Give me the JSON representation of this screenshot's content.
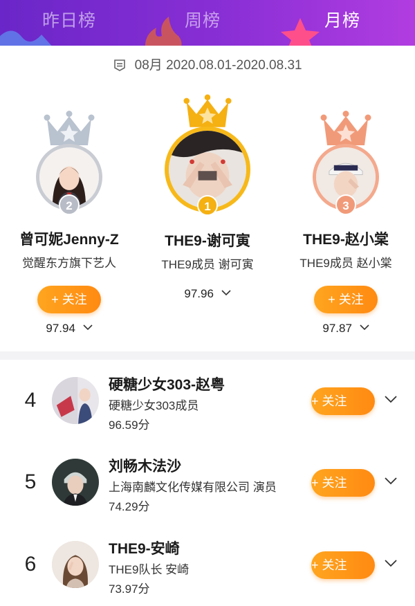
{
  "tabs": [
    {
      "label": "昨日榜",
      "active": false
    },
    {
      "label": "周榜",
      "active": false
    },
    {
      "label": "月榜",
      "active": true
    }
  ],
  "period": {
    "month": "08月",
    "range": "2020.08.01-2020.08.31"
  },
  "podium": [
    {
      "rank": "2",
      "name": "曾可妮Jenny-Z",
      "subtitle": "觉醒东方旗下艺人",
      "follow_label": "+ 关注",
      "score": "97.94",
      "crown_color": "#b9c2cf"
    },
    {
      "rank": "1",
      "name": "THE9-谢可寅",
      "subtitle": "THE9成员 谢可寅",
      "score": "97.96",
      "crown_color": "#f5b012"
    },
    {
      "rank": "3",
      "name": "THE9-赵小棠",
      "subtitle": "THE9成员 赵小棠",
      "follow_label": "+ 关注",
      "score": "97.87",
      "crown_color": "#f19a79"
    }
  ],
  "list": [
    {
      "rank": "4",
      "name": "硬糖少女303-赵粤",
      "subtitle": "硬糖少女303成员",
      "score": "96.59分",
      "follow_label": "+ 关注"
    },
    {
      "rank": "5",
      "name": "刘畅木法沙",
      "subtitle": "上海南麟文化传媒有限公司 演员",
      "score": "74.29分",
      "follow_label": "+ 关注"
    },
    {
      "rank": "6",
      "name": "THE9-安崎",
      "subtitle": "THE9队长 安崎",
      "score": "73.97分",
      "follow_label": "+ 关注"
    }
  ],
  "colors": {
    "header_start": "#6a26c8",
    "header_end": "#b13de0",
    "follow_button": "#ff9a18"
  }
}
